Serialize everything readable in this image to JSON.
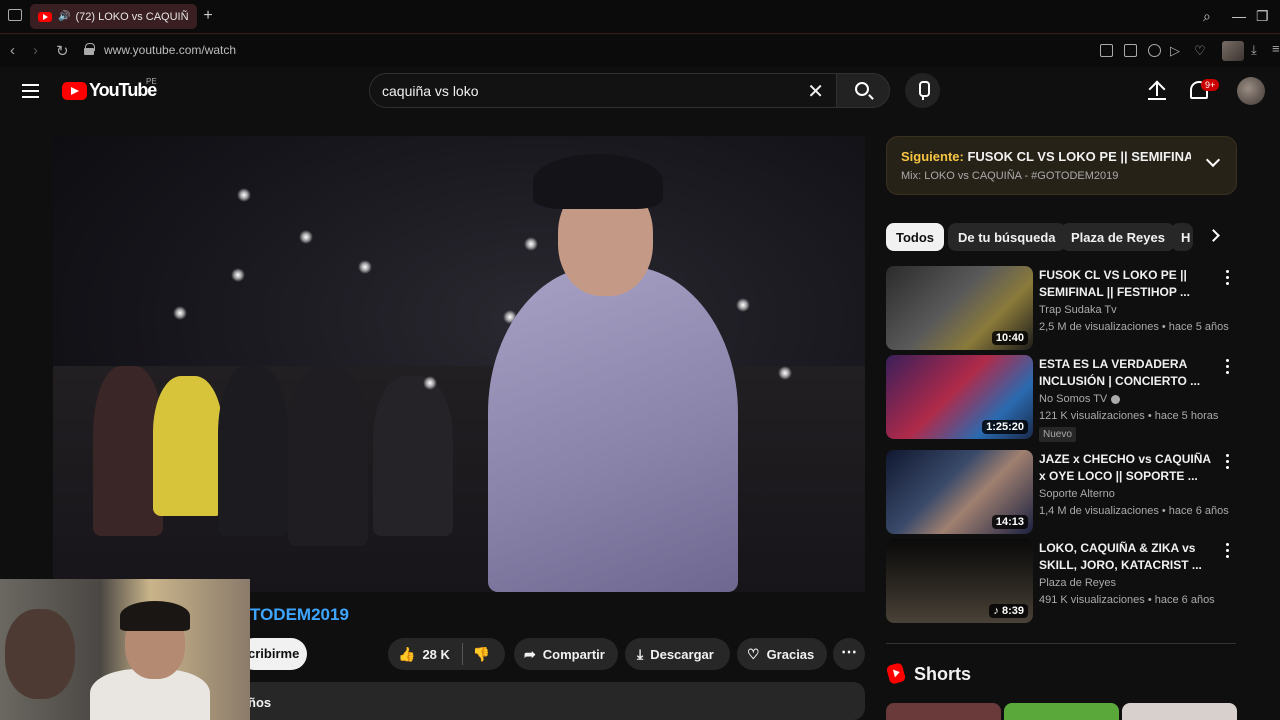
{
  "browser": {
    "tab_title": "(72) LOKO vs CAQUIÑ",
    "url": "www.youtube.com/watch"
  },
  "header": {
    "logo_text": "YouTube",
    "country_code": "PE",
    "search_value": "caquiña vs loko",
    "notifications_badge": "9+"
  },
  "video": {
    "title_visible": "TODEM2019",
    "subscribe_label": "cribirme",
    "like_count": "28 K",
    "share_label": "Compartir",
    "download_label": "Descargar",
    "thanks_label": "Gracias",
    "description_snippet": "ños"
  },
  "next_up": {
    "label": "Siguiente:",
    "title": "FUSOK CL VS LOKO PE || SEMIFINAL || FE...",
    "subtitle": "Mix: LOKO vs CAQUIÑA - #GOTODEM2019"
  },
  "chips": [
    "Todos",
    "De tu búsqueda",
    "Plaza de Reyes",
    "H"
  ],
  "recommendations": [
    {
      "title": "FUSOK CL VS LOKO PE || SEMIFINAL || FESTIHOP ...",
      "channel": "Trap Sudaka Tv",
      "meta": "2,5 M de visualizaciones • hace 5 años",
      "duration": "10:40",
      "badge": ""
    },
    {
      "title": "ESTA ES LA VERDADERA INCLUSIÓN | CONCIERTO ...",
      "channel": "No Somos TV",
      "meta": "121 K visualizaciones • hace 5 horas",
      "duration": "1:25:20",
      "badge": "Nuevo"
    },
    {
      "title": "JAZE x CHECHO vs CAQUIÑA x OYE LOCO || SOPORTE ...",
      "channel": "Soporte Alterno",
      "meta": "1,4 M de visualizaciones • hace 6 años",
      "duration": "14:13",
      "badge": ""
    },
    {
      "title": "LOKO, CAQUIÑA & ZIKA vs SKILL, JORO, KATACRIST ...",
      "channel": "Plaza de Reyes",
      "meta": "491 K visualizaciones • hace 6 años",
      "duration": "8:39",
      "badge": ""
    }
  ],
  "shorts": {
    "label": "Shorts"
  },
  "colors": {
    "accent": "#ff0000",
    "link": "#3ea6ff",
    "next_gold": "#f5c542"
  }
}
